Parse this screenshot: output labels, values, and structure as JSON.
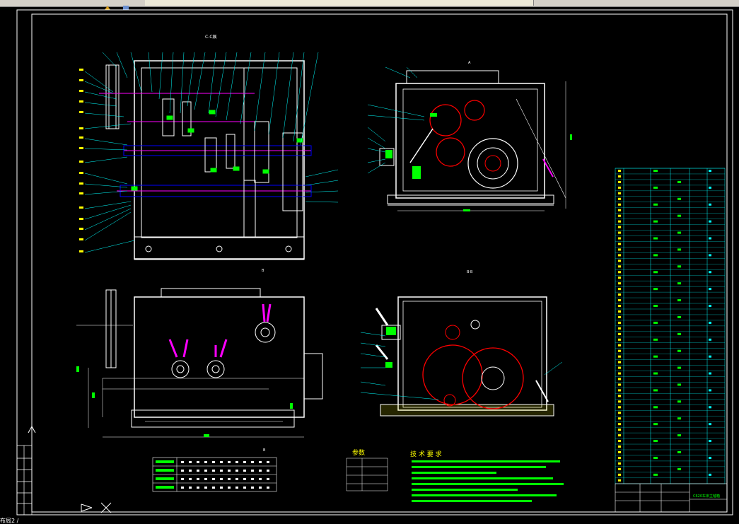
{
  "toolbar": {
    "tabs": [
      "",
      "",
      "",
      "",
      "",
      ""
    ],
    "icons": [
      "layer-tool-icon",
      "cube-tool-icon"
    ]
  },
  "drawing": {
    "section_cc_label": "C-C展",
    "section_bb_label": "B-B",
    "view_a_label": "A",
    "view_b_label": "B",
    "params_title": "参数",
    "tech_title": "技 术 要 求",
    "title_block_name": "C620车床主轴箱"
  },
  "status_bar": {
    "layout_label": "布局2 /"
  },
  "colors": {
    "background": "#000000",
    "frame": "#ffffff",
    "primary_line": "#ffffff",
    "dimension": "#00ff00",
    "leader": "#00ffff",
    "gear_red": "#ff0000",
    "shaft_blue": "#0000ff",
    "magenta": "#ff00ff",
    "yellow": "#ffff00"
  }
}
